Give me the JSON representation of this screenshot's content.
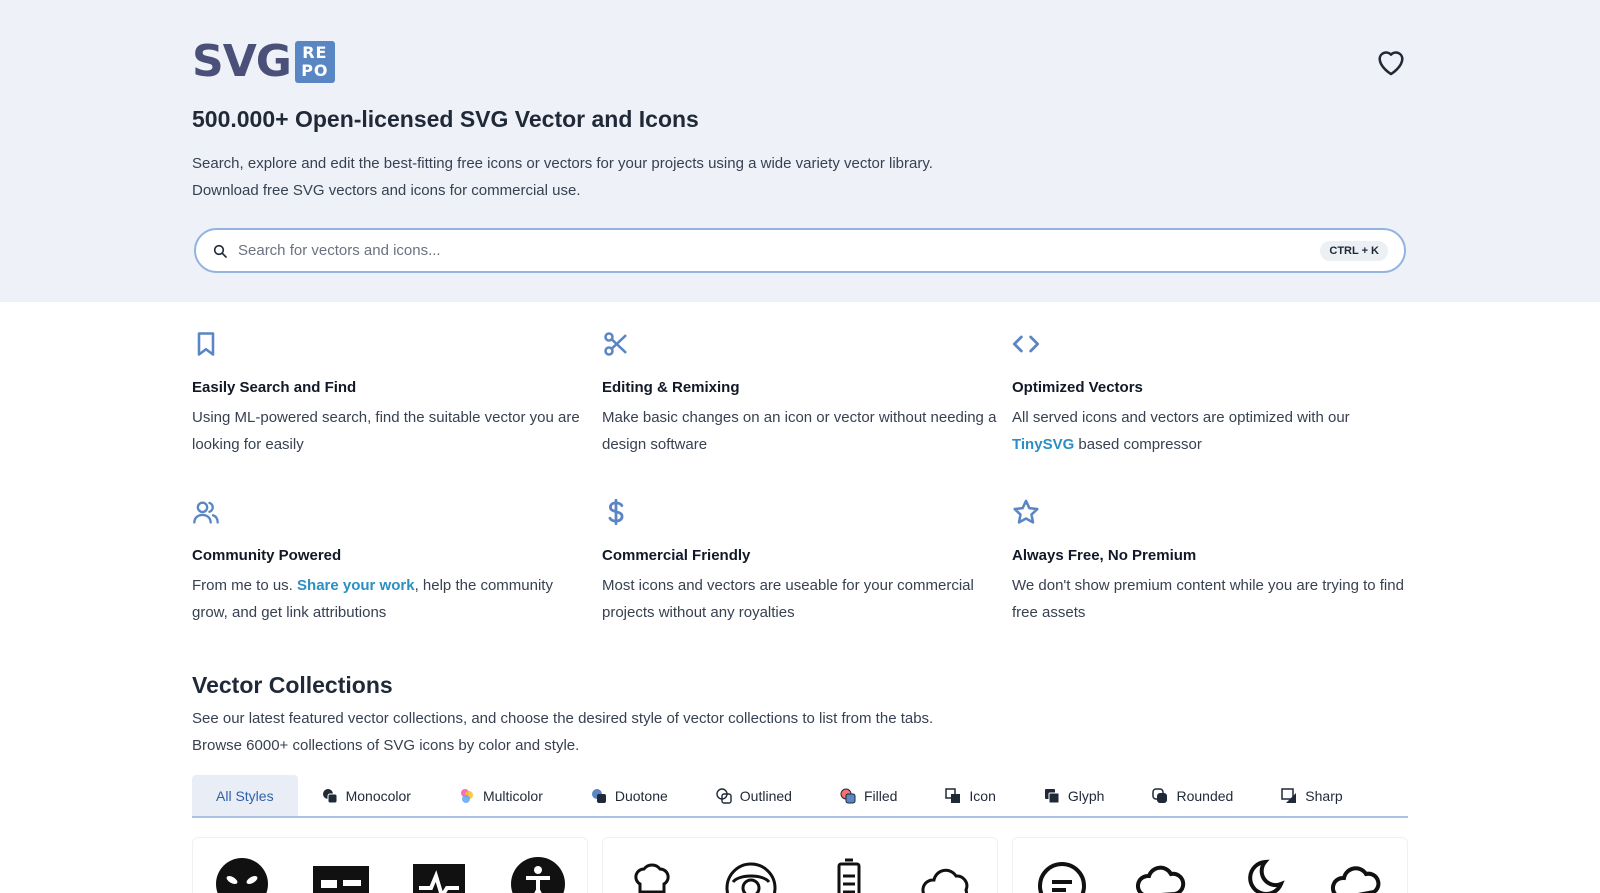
{
  "logo": {
    "text": "SVG",
    "badge_top": "RE",
    "badge_bottom": "PO"
  },
  "hero": {
    "title": "500.000+ Open-licensed SVG Vector and Icons",
    "desc_line1": "Search, explore and edit the best-fitting free icons or vectors for your projects using a wide variety vector library.",
    "desc_line2": "Download free SVG vectors and icons for commercial use."
  },
  "search": {
    "placeholder": "Search for vectors and icons...",
    "shortcut": "CTRL + K"
  },
  "features": [
    {
      "icon": "bookmark-icon",
      "title": "Easily Search and Find",
      "text": "Using ML-powered search, find the suitable vector you are looking for easily"
    },
    {
      "icon": "scissors-icon",
      "title": "Editing & Remixing",
      "text": "Make basic changes on an icon or vector without needing a design software"
    },
    {
      "icon": "code-icon",
      "title": "Optimized Vectors",
      "text_before": "All served icons and vectors are optimized with our ",
      "link": "TinySVG",
      "text_after": " based compressor"
    },
    {
      "icon": "users-icon",
      "title": "Community Powered",
      "text_before": "From me to us. ",
      "link": "Share your work",
      "text_after": ", help the community grow, and get link attributions"
    },
    {
      "icon": "dollar-icon",
      "title": "Commercial Friendly",
      "text": "Most icons and vectors are useable for your commercial projects without any royalties"
    },
    {
      "icon": "star-icon",
      "title": "Always Free, No Premium",
      "text": "We don't show premium content while you are trying to find free assets"
    }
  ],
  "collections": {
    "title": "Vector Collections",
    "desc_line1": "See our latest featured vector collections, and choose the desired style of vector collections to list from the tabs.",
    "desc_line2": "Browse 6000+ collections of SVG icons by color and style."
  },
  "tabs": [
    {
      "label": "All Styles",
      "active": true
    },
    {
      "label": "Monocolor",
      "icon": "monocolor-icon"
    },
    {
      "label": "Multicolor",
      "icon": "multicolor-icon"
    },
    {
      "label": "Duotone",
      "icon": "duotone-icon"
    },
    {
      "label": "Outlined",
      "icon": "outlined-icon"
    },
    {
      "label": "Filled",
      "icon": "filled-icon"
    },
    {
      "label": "Icon",
      "icon": "icon-style-icon"
    },
    {
      "label": "Glyph",
      "icon": "glyph-icon"
    },
    {
      "label": "Rounded",
      "icon": "rounded-icon"
    },
    {
      "label": "Sharp",
      "icon": "sharp-icon"
    }
  ],
  "colors": {
    "accent": "#5a86c4",
    "link": "#2b8fc4",
    "hero_bg": "#eef2f8",
    "logo_text": "#4b5079"
  }
}
